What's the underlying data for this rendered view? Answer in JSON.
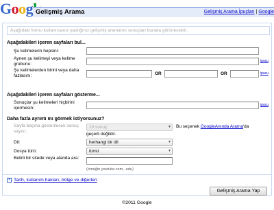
{
  "logo": {
    "letters": [
      "G",
      "o",
      "o",
      "g",
      "l",
      "e"
    ]
  },
  "header": {
    "title": "Gelişmiş Arama",
    "tips_link": "Gelişmiş Arama İpuçları",
    "separator": "|",
    "about_link": "Google"
  },
  "preview_text": "Aşağıdaki formu kullanırsanız yaptığınız gelişmiş aramanın sonuçları burada görünecektir.",
  "find": {
    "heading": "Aşağıdakileri içeren sayfaları bul...",
    "all_words_label": "Şu kelimelerin hepsini:",
    "exact_label": "Aynen şu kelimeyi veya kelime grubunu:",
    "any_label": "Şu kelimelerden birini veya daha fazlasını:",
    "or_label": "OR",
    "tip": "ipucu"
  },
  "exclude": {
    "heading": "Aşağıdakileri içeren sayfaları gösterme...",
    "label": "Sonuçlar şu kelimeleri hiçbirini içermesin:",
    "tip": "ipucu"
  },
  "more": {
    "heading": "Daha fazla ayrıntı mı görmek istiyorsunuz?",
    "results_label": "Sayfa başına gösterilecek sonuç sayısı:",
    "results_value": "10 sonuç",
    "results_note_prefix": "Bu seçenek ",
    "results_note_link": "GoogleAnında Arama",
    "results_note_suffix": "'da",
    "results_note_line2": "geçerli değildir.",
    "language_label": "Dil:",
    "language_value": "herhangi bir dil",
    "filetype_label": "Dosya türü:",
    "filetype_value": "tümü",
    "site_label": "Belirli bir sitede veya alanda ara:",
    "site_example": "(örneğin youtube.com, .edu)"
  },
  "expand_link": "Tarih, kullanım hakları, bölge ve diğerleri",
  "submit_label": "Gelişmiş Arama Yap",
  "footer": "©2011 Google"
}
